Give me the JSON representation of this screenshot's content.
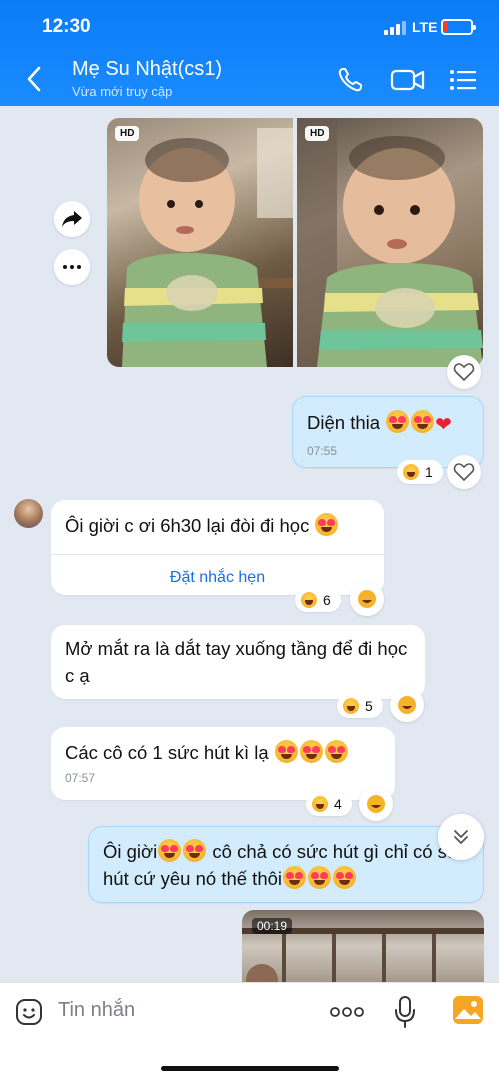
{
  "status_bar": {
    "time": "12:30",
    "network": "LTE"
  },
  "header": {
    "title": "Mẹ Su Nhật(cs1)",
    "subtitle": "Vừa mới truy cập"
  },
  "messages": {
    "photos": {
      "badge_1": "HD",
      "badge_2": "HD"
    },
    "msg1": {
      "text": "Diện thia",
      "time": "07:55",
      "reaction_count": "1"
    },
    "msg2": {
      "text": "Ôi giời c ơi 6h30 lại đòi đi học",
      "reminder": "Đặt nhắc hẹn",
      "reaction_count": "6"
    },
    "msg3": {
      "text": "Mở mắt ra là dắt tay xuống tầng để đi học c ạ",
      "reaction_count": "5"
    },
    "msg4": {
      "text": "Các cô có 1 sức hút kì lạ",
      "time": "07:57",
      "reaction_count": "4"
    },
    "msg5": {
      "text_a": "Ôi giời",
      "text_b": " cô chả có sức hút gì chỉ có sức hút cứ yêu nó thế thôi"
    },
    "video": {
      "duration": "00:19"
    }
  },
  "input": {
    "placeholder": "Tin nhắn"
  },
  "icons": [
    "back-icon",
    "phone-icon",
    "video-call-icon",
    "list-menu-icon",
    "forward-icon",
    "more-icon",
    "heart-outline-icon",
    "sticker-icon",
    "more-dots-icon",
    "mic-icon",
    "gallery-icon",
    "chevron-down-icon"
  ],
  "colors": {
    "header": "#1b8bff",
    "outgoing_bubble": "#d3ecfd",
    "link": "#1a6fe0",
    "background": "#e2e8f2"
  }
}
